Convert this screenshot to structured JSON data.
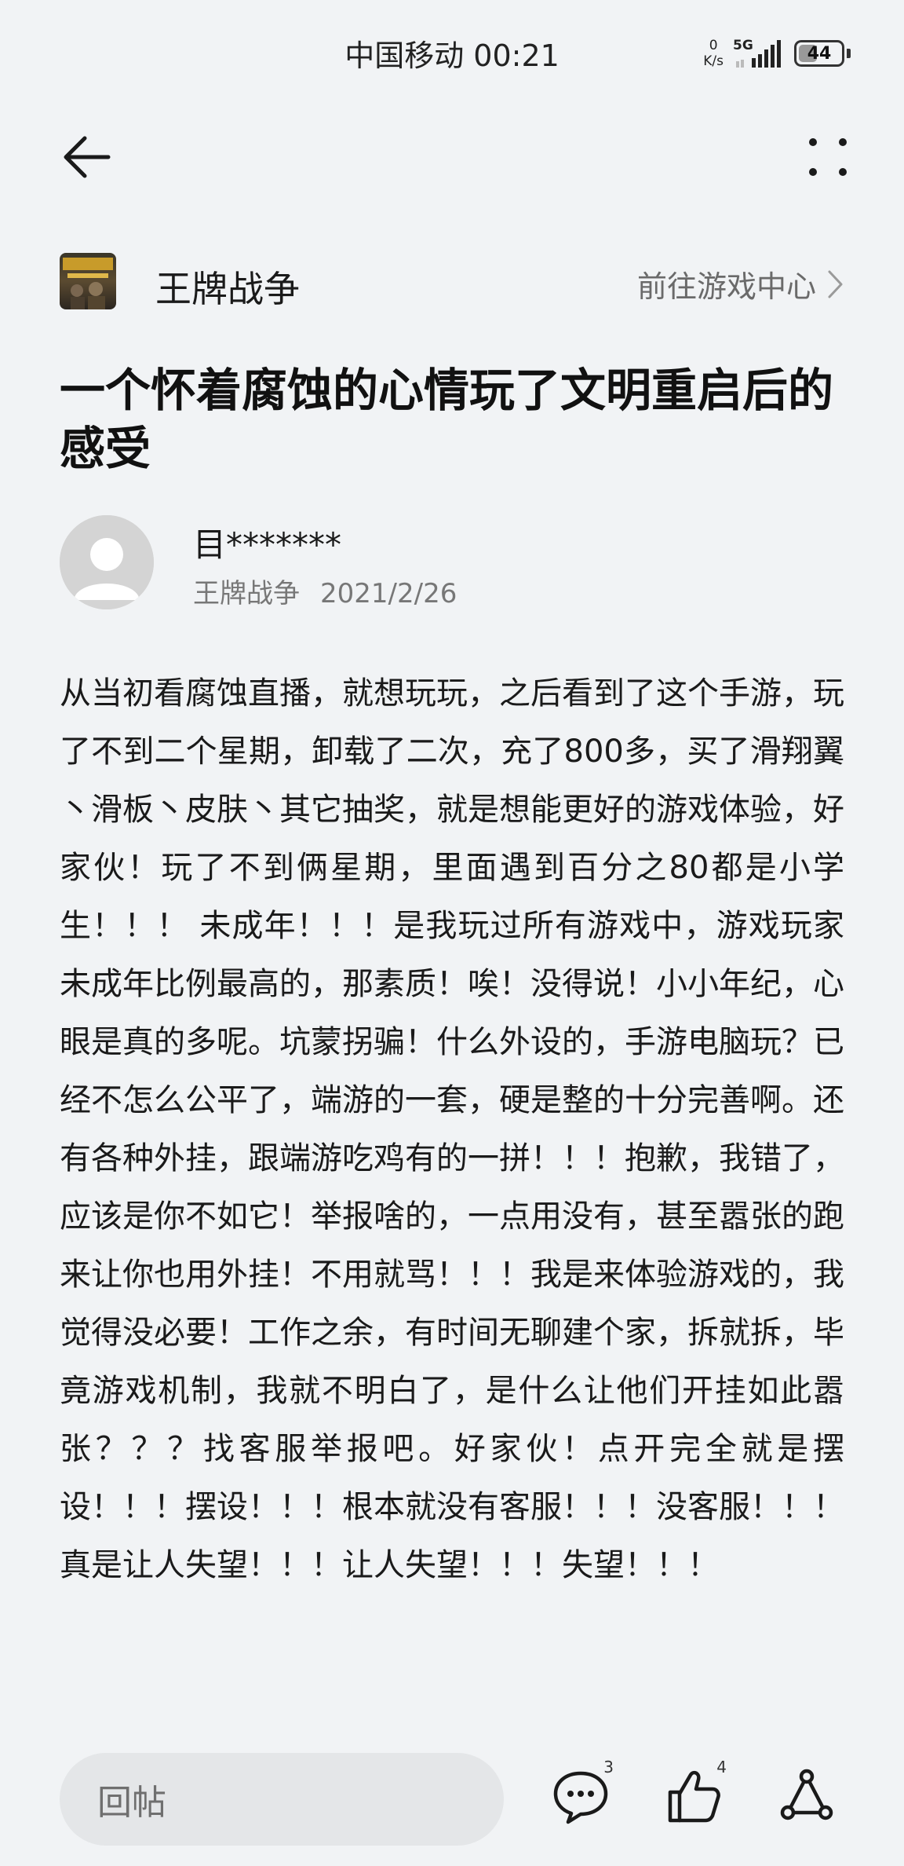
{
  "status_bar": {
    "carrier_time": "中国移动 00:21",
    "net_speed_value": "0",
    "net_speed_unit": "K/s",
    "network_type": "5G",
    "battery_level": "44"
  },
  "nav": {
    "back_icon": "back-arrow-icon",
    "more_icon": "more-dots-icon"
  },
  "game": {
    "name": "王牌战争",
    "goto_label": "前往游戏中心"
  },
  "post": {
    "title": "一个怀着腐蚀的心情玩了文明重启后的感受",
    "author": "目*******",
    "forum": "王牌战争",
    "date": "2021/2/26",
    "body": "从当初看腐蚀直播，就想玩玩，之后看到了这个手游，玩了不到二个星期，卸载了二次，充了800多，买了滑翔翼丶滑板丶皮肤丶其它抽奖，就是想能更好的游戏体验，好家伙！玩了不到俩星期，里面遇到百分之80都是小学生！！！ 未成年！！！是我玩过所有游戏中，游戏玩家未成年比例最高的，那素质！唉！没得说！小小年纪，心眼是真的多呢。坑蒙拐骗！什么外设的，手游电脑玩？已经不怎么公平了，端游的一套，硬是整的十分完善啊。还有各种外挂，跟端游吃鸡有的一拼！！！抱歉，我错了，应该是你不如它！举报啥的，一点用没有，甚至嚣张的跑来让你也用外挂！不用就骂！！！我是来体验游戏的，我觉得没必要！工作之余，有时间无聊建个家，拆就拆，毕竟游戏机制，我就不明白了，是什么让他们开挂如此嚣张？？？找客服举报吧。好家伙！点开完全就是摆设！！！摆设！！！根本就没有客服！！！没客服！！！真是让人失望！！！让人失望！！！失望！！！"
  },
  "bottom_bar": {
    "reply_placeholder": "回帖",
    "comment_count": "3",
    "like_count": "4"
  }
}
